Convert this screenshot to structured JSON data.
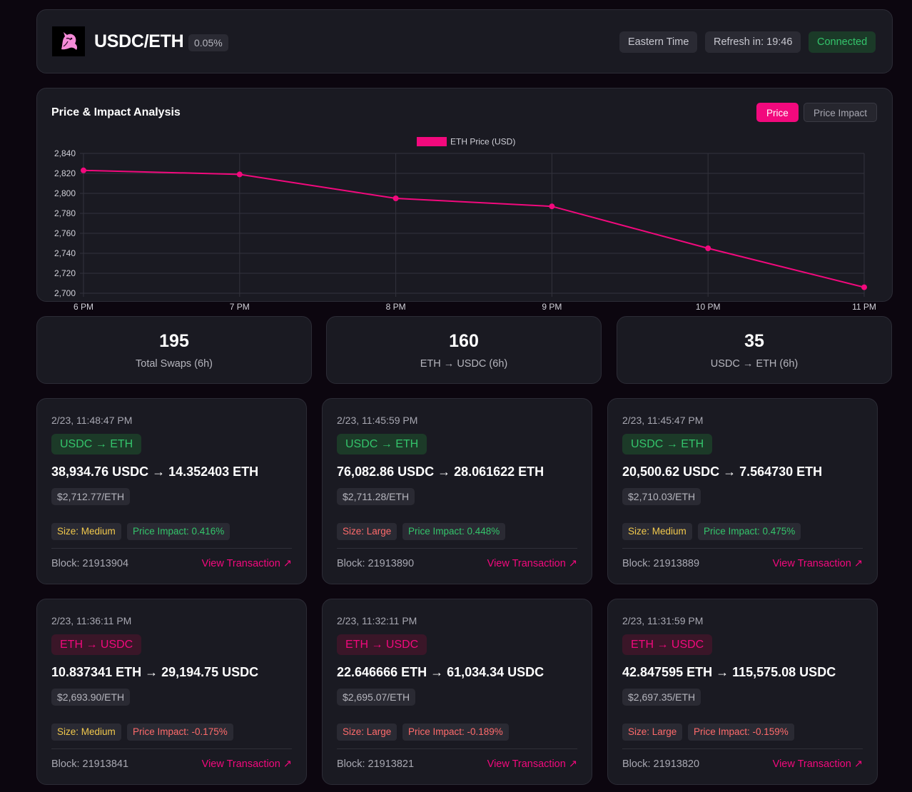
{
  "header": {
    "logo_icon": "unicorn-logo-icon",
    "pair": "USDC/ETH",
    "fee": "0.05%",
    "timezone": "Eastern Time",
    "refresh": "Refresh in: 19:46",
    "status": "Connected"
  },
  "chart": {
    "title": "Price & Impact Analysis",
    "tabs": [
      {
        "label": "Price",
        "active": true
      },
      {
        "label": "Price Impact",
        "active": false
      }
    ]
  },
  "chart_data": {
    "type": "line",
    "x": [
      "6 PM",
      "7 PM",
      "8 PM",
      "9 PM",
      "10 PM",
      "11 PM"
    ],
    "series": [
      {
        "name": "ETH Price (USD)",
        "values": [
          2823,
          2819,
          2795,
          2787,
          2745,
          2706
        ],
        "color": "#f2097d"
      }
    ],
    "ylim": [
      2700,
      2840
    ],
    "yticks": [
      "2,840",
      "2,820",
      "2,800",
      "2,780",
      "2,760",
      "2,740",
      "2,720",
      "2,700"
    ],
    "grid": true,
    "legend": "top-center"
  },
  "stats": [
    {
      "value": "195",
      "label": "Total Swaps (6h)"
    },
    {
      "value": "160",
      "label": "ETH → USDC (6h)"
    },
    {
      "value": "35",
      "label": "USDC → ETH (6h)"
    }
  ],
  "swaps": [
    {
      "time": "2/23, 11:48:47 PM",
      "direction": "USDC → ETH",
      "amount": "38,934.76 USDC → 14.352403 ETH",
      "price": "$2,712.77/ETH",
      "size": "Size: Medium",
      "impact": "Price Impact: 0.416%",
      "block": "Block: 21913904",
      "link": "View Transaction ↗"
    },
    {
      "time": "2/23, 11:45:59 PM",
      "direction": "USDC → ETH",
      "amount": "76,082.86 USDC → 28.061622 ETH",
      "price": "$2,711.28/ETH",
      "size": "Size: Large",
      "impact": "Price Impact: 0.448%",
      "block": "Block: 21913890",
      "link": "View Transaction ↗"
    },
    {
      "time": "2/23, 11:45:47 PM",
      "direction": "USDC → ETH",
      "amount": "20,500.62 USDC → 7.564730 ETH",
      "price": "$2,710.03/ETH",
      "size": "Size: Medium",
      "impact": "Price Impact: 0.475%",
      "block": "Block: 21913889",
      "link": "View Transaction ↗"
    },
    {
      "time": "2/23, 11:36:11 PM",
      "direction": "ETH → USDC",
      "amount": "10.837341 ETH → 29,194.75 USDC",
      "price": "$2,693.90/ETH",
      "size": "Size: Medium",
      "impact": "Price Impact: -0.175%",
      "block": "Block: 21913841",
      "link": "View Transaction ↗"
    },
    {
      "time": "2/23, 11:32:11 PM",
      "direction": "ETH → USDC",
      "amount": "22.646666 ETH → 61,034.34 USDC",
      "price": "$2,695.07/ETH",
      "size": "Size: Large",
      "impact": "Price Impact: -0.189%",
      "block": "Block: 21913821",
      "link": "View Transaction ↗"
    },
    {
      "time": "2/23, 11:31:59 PM",
      "direction": "ETH → USDC",
      "amount": "42.847595 ETH → 115,575.08 USDC",
      "price": "$2,697.35/ETH",
      "size": "Size: Large",
      "impact": "Price Impact: -0.159%",
      "block": "Block: 21913820",
      "link": "View Transaction ↗"
    }
  ]
}
